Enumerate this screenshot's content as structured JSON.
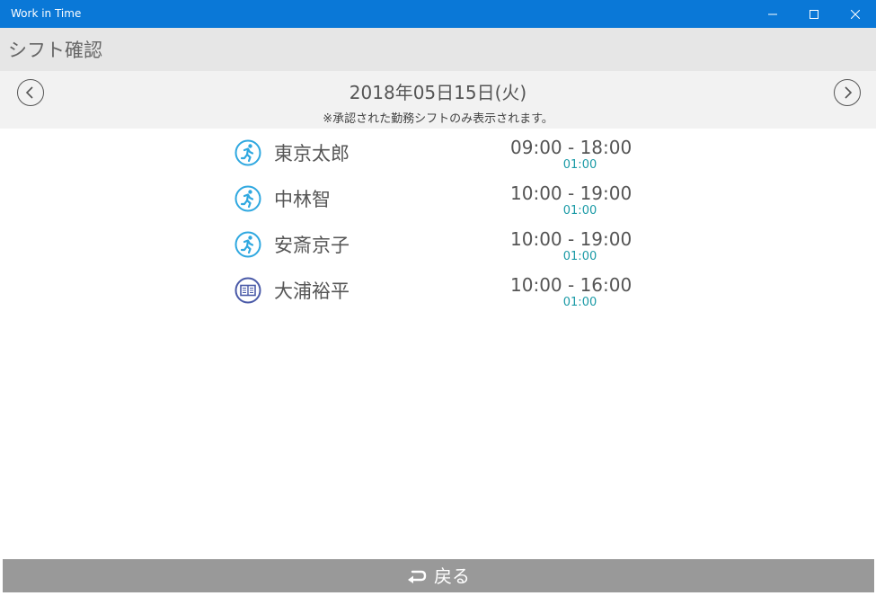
{
  "window": {
    "title": "Work in Time",
    "accent": "#0a78d7"
  },
  "header": {
    "title": "シフト確認"
  },
  "date_nav": {
    "date": "2018年05日15日(火)",
    "note": "※承認された勤務シフトのみ表示されます。",
    "prev_icon": "chevron-left-circle-icon",
    "next_icon": "chevron-right-circle-icon"
  },
  "shifts": [
    {
      "icon": "running-person-icon",
      "name": "東京太郎",
      "time": "09:00 - 18:00",
      "break": "01:00"
    },
    {
      "icon": "running-person-icon",
      "name": "中林智",
      "time": "10:00 - 19:00",
      "break": "01:00"
    },
    {
      "icon": "running-person-icon",
      "name": "安斎京子",
      "time": "10:00 - 19:00",
      "break": "01:00"
    },
    {
      "icon": "book-icon",
      "name": "大浦裕平",
      "time": "10:00 - 16:00",
      "break": "01:00"
    }
  ],
  "footer": {
    "back_label": "戻る",
    "back_icon": "return-arrow-icon"
  },
  "colors": {
    "break_text": "#1a9aa6",
    "running_icon": "#2fa8e0",
    "book_icon": "#4a5aa8",
    "footer_bg": "#999999"
  }
}
